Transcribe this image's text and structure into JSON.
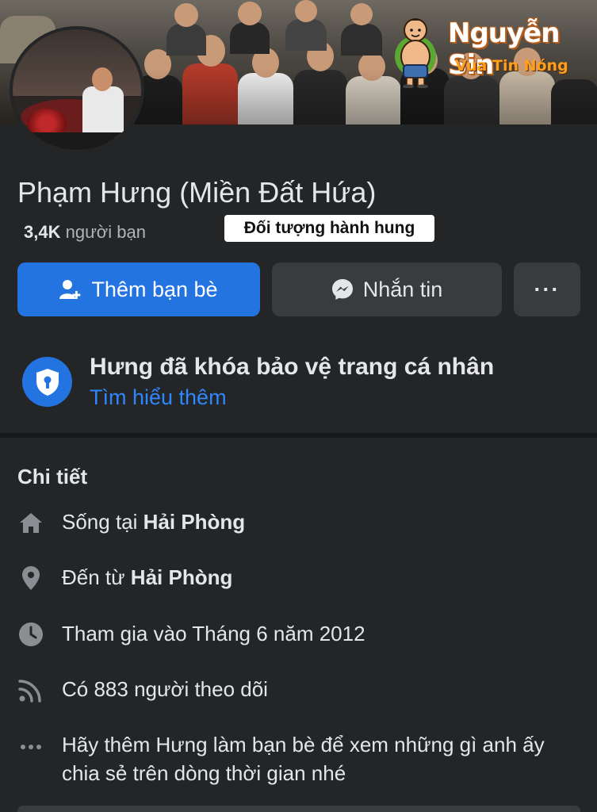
{
  "watermark": {
    "name": "Nguyễn Sin",
    "slogan": "Vua Tin Nóng"
  },
  "profile": {
    "name": "Phạm Hưng (Miền Đất Hứa)",
    "friends_count": "3,4K",
    "friends_label": "người bạn",
    "caption_badge": "Đối tượng hành hung"
  },
  "actions": {
    "add_friend_label": "Thêm bạn bè",
    "message_label": "Nhắn tin",
    "more_label": "···"
  },
  "lock_notice": {
    "title": "Hưng đã khóa bảo vệ trang cá nhân",
    "link": "Tìm hiểu thêm"
  },
  "details": {
    "title": "Chi tiết",
    "lives_prefix": "Sống tại",
    "lives_place": "Hải Phòng",
    "from_prefix": "Đến từ",
    "from_place": "Hải Phòng",
    "joined": "Tham gia vào Tháng 6 năm 2012",
    "followers": "Có 883 người theo dõi",
    "add_friend_hint": "Hãy thêm Hưng làm bạn bè để xem những gì anh ấy chia sẻ trên dòng thời gian nhé"
  },
  "icons": {
    "home": "home-icon",
    "location": "location-pin-icon",
    "clock": "clock-icon",
    "rss": "followers-rss-icon",
    "more": "more-dots-icon",
    "add_friend": "add-friend-icon",
    "messenger": "messenger-icon",
    "shield": "shield-lock-icon"
  },
  "colors": {
    "background": "#242526",
    "primary_button": "#2374e1",
    "secondary_button": "#3a3b3c",
    "link": "#2d88ff",
    "text": "#e4e6eb",
    "muted_text": "#b0b3b8",
    "watermark_slogan": "#ff9f1c"
  }
}
